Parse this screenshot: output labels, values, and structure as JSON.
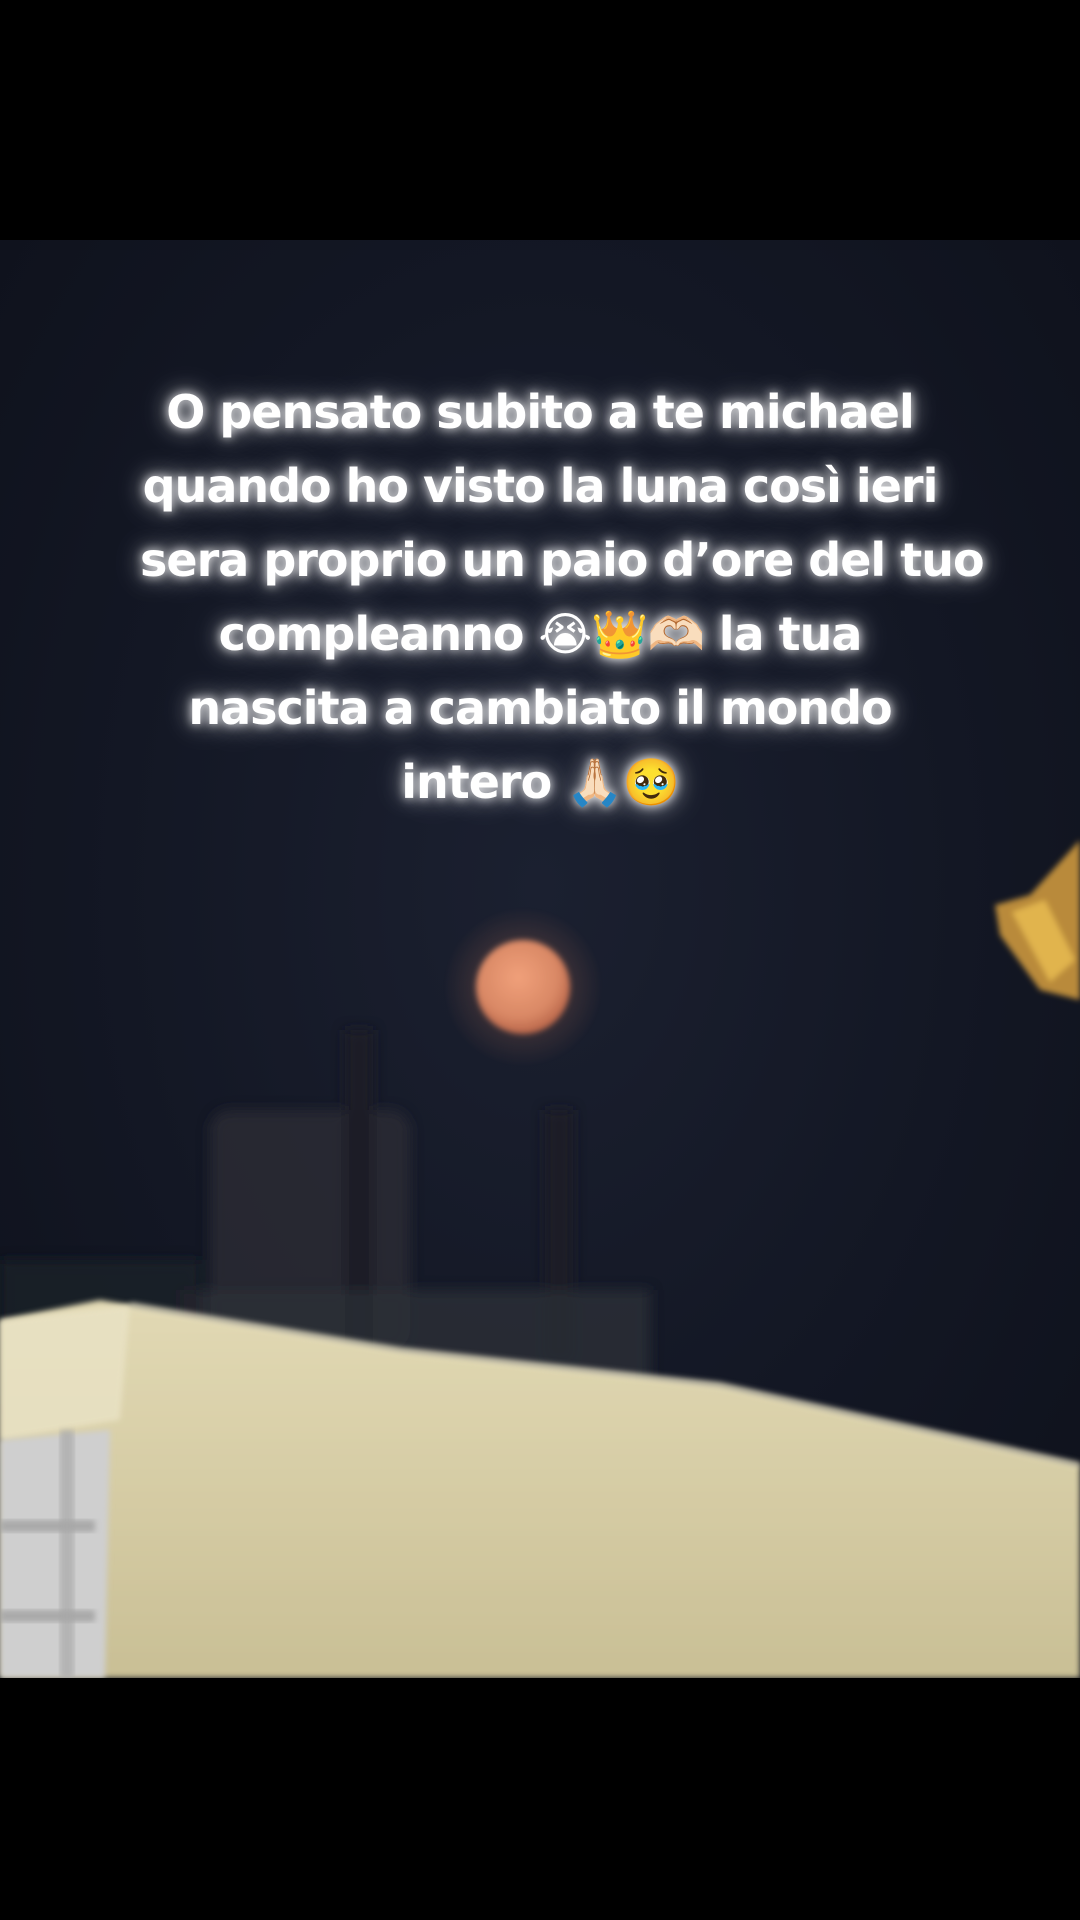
{
  "caption": {
    "lines": [
      "O pensato subito a te michael",
      "quando ho visto la luna così ieri",
      "sera proprio un paio d’ore del tuo",
      "compleanno 😭👑🫶🏻 la tua",
      "nascita a cambiato il mondo",
      "intero 🙏🏻🥹"
    ]
  },
  "scene": {
    "subject": "orange full moon over rooftops at night",
    "colors": {
      "sky": "#151a28",
      "moon": "#d98865",
      "awning": "#d8cfa8",
      "bars": "#000000"
    }
  }
}
